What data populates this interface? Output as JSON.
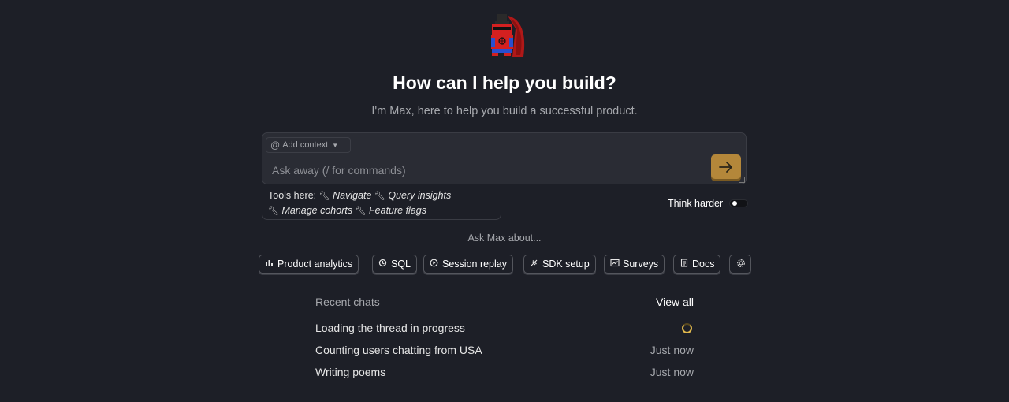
{
  "hero": {
    "title": "How can I help you build?",
    "subtitle": "I'm Max, here to help you build a successful product."
  },
  "composer": {
    "add_context_label": "Add context",
    "placeholder": "Ask away (/ for commands)",
    "send_icon": "arrow-right-icon",
    "accent_color": "#b4873a"
  },
  "tools": {
    "prefix": "Tools here:",
    "items": [
      "Navigate",
      "Query insights",
      "Manage cohorts",
      "Feature flags"
    ]
  },
  "think_harder": {
    "label": "Think harder",
    "enabled": false
  },
  "suggestions": {
    "heading": "Ask Max about...",
    "chips": [
      {
        "label": "Product analytics",
        "icon": "bar-chart-icon"
      },
      {
        "label": "SQL",
        "icon": "sql-icon"
      },
      {
        "label": "Session replay",
        "icon": "play-icon"
      },
      {
        "label": "SDK setup",
        "icon": "plug-icon"
      },
      {
        "label": "Surveys",
        "icon": "survey-icon"
      },
      {
        "label": "Docs",
        "icon": "doc-icon"
      },
      {
        "label": "",
        "icon": "gear-icon"
      }
    ]
  },
  "recent": {
    "label": "Recent chats",
    "view_all": "View all",
    "chats": [
      {
        "title": "Loading the thread in progress",
        "time": "",
        "status": "loading"
      },
      {
        "title": "Counting users chatting from USA",
        "time": "Just now"
      },
      {
        "title": "Writing poems",
        "time": "Just now"
      }
    ]
  }
}
